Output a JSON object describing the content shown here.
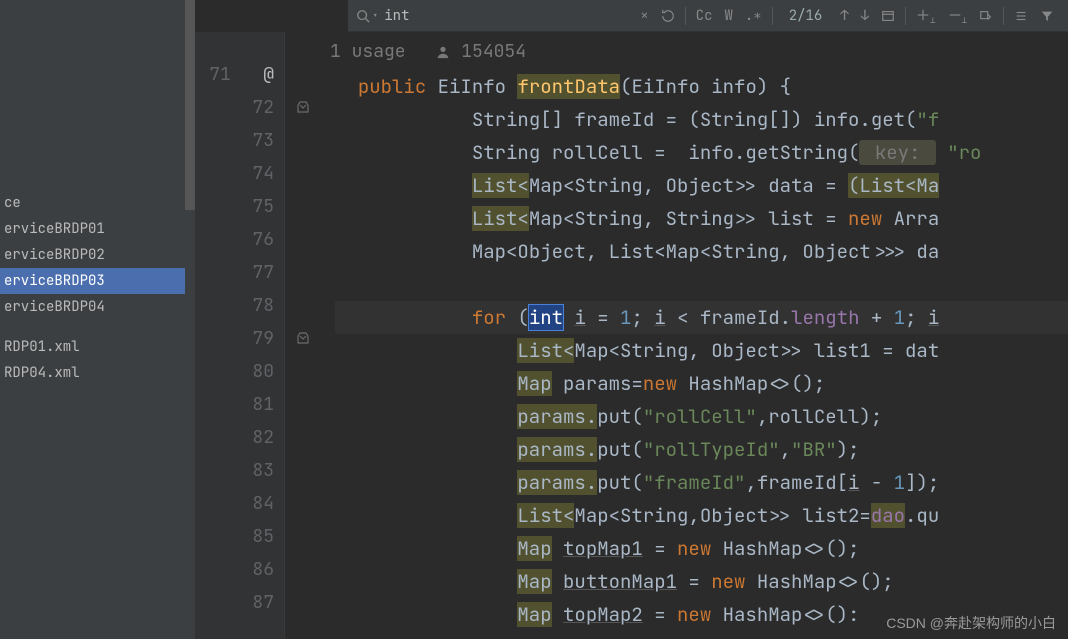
{
  "find": {
    "query": "int",
    "hits": "2/16",
    "cc_label": "Cc",
    "w_label": "W"
  },
  "sidebar": {
    "items": [
      {
        "label": "ce"
      },
      {
        "label": "erviceBRDP01"
      },
      {
        "label": "erviceBRDP02"
      },
      {
        "label": "erviceBRDP03"
      },
      {
        "label": "erviceBRDP04"
      },
      {
        "label": "RDP01.xml"
      },
      {
        "label": "RDP04.xml"
      }
    ],
    "selected_index": 3
  },
  "meta": {
    "usages": "1 usage",
    "author": "154054"
  },
  "gutter": {
    "start": 71,
    "end": 87,
    "annotation_line": 71,
    "annotation_glyph": "@"
  },
  "code": {
    "lines": [
      {
        "n": 71,
        "tokens": [
          {
            "t": "public ",
            "c": "k"
          },
          {
            "t": "EiInfo "
          },
          {
            "t": "frontData",
            "c": "mname highlight"
          },
          {
            "t": "(EiInfo info) {"
          }
        ],
        "indent": 0
      },
      {
        "n": 72,
        "tokens": [
          {
            "t": "String[] frameId = (String[]) info.get("
          },
          {
            "t": "\"f",
            "c": "str"
          }
        ],
        "indent": 1
      },
      {
        "n": 73,
        "tokens": [
          {
            "t": "String rollCell =  info.getString("
          },
          {
            "t": " key: ",
            "c": "hint"
          },
          {
            "t": " "
          },
          {
            "t": "\"ro",
            "c": "str"
          }
        ],
        "indent": 1
      },
      {
        "n": 74,
        "tokens": [
          {
            "t": "List<",
            "c": "highlight"
          },
          {
            "t": "Map<String, Object>> data = "
          },
          {
            "t": "(List<Ma",
            "c": "highlight"
          }
        ],
        "indent": 1
      },
      {
        "n": 75,
        "tokens": [
          {
            "t": "List<",
            "c": "highlight"
          },
          {
            "t": "Map<String, String>> list = "
          },
          {
            "t": "new",
            "c": "k"
          },
          {
            "t": " Arra"
          }
        ],
        "indent": 1
      },
      {
        "n": 76,
        "tokens": [
          {
            "t": "Map<Object, List<Map<String, Object>>> da"
          }
        ],
        "indent": 1
      },
      {
        "n": 77,
        "tokens": [
          {
            "t": ""
          }
        ],
        "indent": 1
      },
      {
        "n": 78,
        "tokens": [
          {
            "t": "for",
            "c": "k"
          },
          {
            "t": " ("
          },
          {
            "t": "int",
            "c": "k sel"
          },
          {
            "t": " "
          },
          {
            "t": "i",
            "c": "param"
          },
          {
            "t": " = "
          },
          {
            "t": "1",
            "c": "num"
          },
          {
            "t": "; "
          },
          {
            "t": "i",
            "c": "param"
          },
          {
            "t": " < frameId."
          },
          {
            "t": "length",
            "c": "fld"
          },
          {
            "t": " + "
          },
          {
            "t": "1",
            "c": "num"
          },
          {
            "t": "; "
          },
          {
            "t": "i",
            "c": "param"
          }
        ],
        "indent": 1,
        "current": true
      },
      {
        "n": 79,
        "tokens": [
          {
            "t": "List<",
            "c": "highlight"
          },
          {
            "t": "Map<String, Object>> list1 = dat"
          }
        ],
        "indent": 2
      },
      {
        "n": 80,
        "tokens": [
          {
            "t": "Map",
            "c": "highlight"
          },
          {
            "t": " params="
          },
          {
            "t": "new",
            "c": "k"
          },
          {
            "t": " HashMap<>();"
          }
        ],
        "indent": 2
      },
      {
        "n": 81,
        "tokens": [
          {
            "t": "params.",
            "c": "highlight"
          },
          {
            "t": "put("
          },
          {
            "t": "\"rollCell\"",
            "c": "str"
          },
          {
            "t": ",rollCell);"
          }
        ],
        "indent": 2
      },
      {
        "n": 82,
        "tokens": [
          {
            "t": "params.",
            "c": "highlight"
          },
          {
            "t": "put("
          },
          {
            "t": "\"rollTypeId\"",
            "c": "str"
          },
          {
            "t": ","
          },
          {
            "t": "\"BR\"",
            "c": "str"
          },
          {
            "t": ");"
          }
        ],
        "indent": 2
      },
      {
        "n": 83,
        "tokens": [
          {
            "t": "params.",
            "c": "highlight"
          },
          {
            "t": "put("
          },
          {
            "t": "\"frameId\"",
            "c": "str"
          },
          {
            "t": ",frameId["
          },
          {
            "t": "i",
            "c": "param"
          },
          {
            "t": " - "
          },
          {
            "t": "1",
            "c": "num"
          },
          {
            "t": "]);"
          }
        ],
        "indent": 2
      },
      {
        "n": 84,
        "tokens": [
          {
            "t": "List<",
            "c": "highlight"
          },
          {
            "t": "Map<String,Object>> list2="
          },
          {
            "t": "dao",
            "c": "fld highlight"
          },
          {
            "t": ".qu"
          }
        ],
        "indent": 2
      },
      {
        "n": 85,
        "tokens": [
          {
            "t": "Map",
            "c": "highlight"
          },
          {
            "t": " "
          },
          {
            "t": "topMap1",
            "c": "param"
          },
          {
            "t": " = "
          },
          {
            "t": "new",
            "c": "k"
          },
          {
            "t": " HashMap<>();"
          }
        ],
        "indent": 2
      },
      {
        "n": 86,
        "tokens": [
          {
            "t": "Map",
            "c": "highlight"
          },
          {
            "t": " "
          },
          {
            "t": "buttonMap1",
            "c": "param"
          },
          {
            "t": " = "
          },
          {
            "t": "new",
            "c": "k"
          },
          {
            "t": " HashMap<>();"
          }
        ],
        "indent": 2
      },
      {
        "n": 87,
        "tokens": [
          {
            "t": "Map",
            "c": "highlight"
          },
          {
            "t": " "
          },
          {
            "t": "topMap2",
            "c": "param"
          },
          {
            "t": " = "
          },
          {
            "t": "new",
            "c": "k"
          },
          {
            "t": " HashMap<>():",
            "trail": true
          }
        ],
        "indent": 2
      }
    ]
  },
  "watermark": "CSDN @奔赴架构师的小白"
}
